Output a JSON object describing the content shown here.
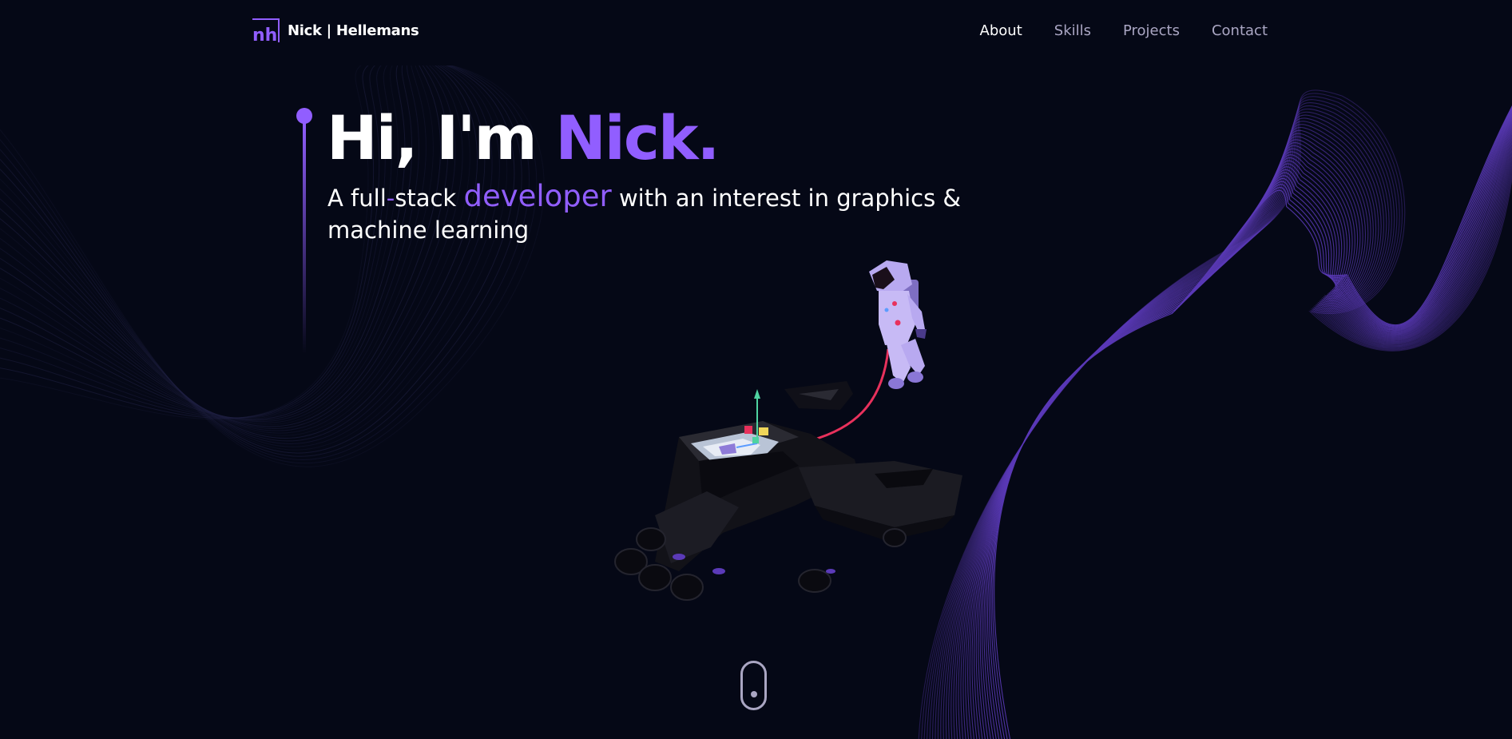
{
  "nav": {
    "logo_initials": "nh",
    "logo_text": "Nick | Hellemans",
    "links": [
      {
        "label": "About",
        "active": true
      },
      {
        "label": "Skills",
        "active": false
      },
      {
        "label": "Projects",
        "active": false
      },
      {
        "label": "Contact",
        "active": false
      }
    ]
  },
  "hero": {
    "title_prefix": "Hi, I'm ",
    "title_name": "Nick.",
    "subtitle_part1": "A full",
    "subtitle_dash": "-",
    "subtitle_part2": "stack ",
    "subtitle_highlight": "developer",
    "subtitle_part3": " with an interest in graphics & machine learning"
  },
  "scene": {
    "description_icons": [
      "astronaut-icon",
      "spaceship-icon"
    ]
  },
  "colors": {
    "background": "#050816",
    "accent": "#915EFF",
    "secondary_text": "#aaa6c3",
    "tether": "#e8315c"
  },
  "icons": {
    "logo": "logo-mark-icon",
    "scroll": "mouse-scroll-icon"
  }
}
